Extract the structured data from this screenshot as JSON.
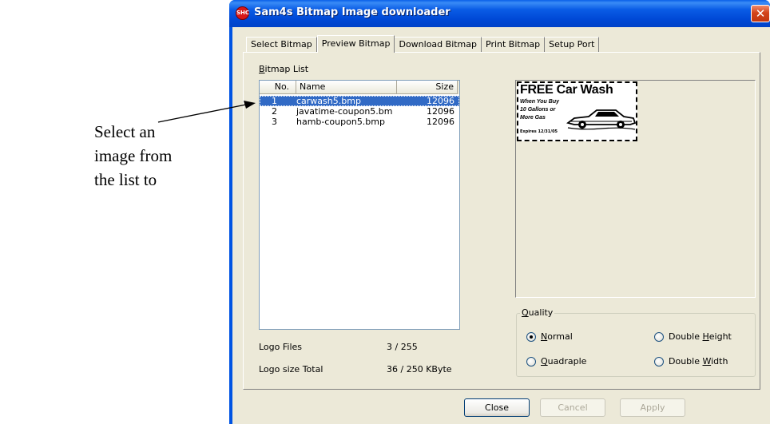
{
  "annotation": {
    "lines": [
      "Select an",
      "image from",
      "the list to"
    ]
  },
  "window": {
    "icon_text": "SHC",
    "title": "Sam4s Bitmap Image downloader",
    "close_glyph": "✕"
  },
  "tabs": [
    {
      "label": "Select Bitmap",
      "active": false
    },
    {
      "label": "Preview Bitmap",
      "active": true
    },
    {
      "label": "Download Bitmap",
      "active": false
    },
    {
      "label": "Print Bitmap",
      "active": false
    },
    {
      "label": "Setup Port",
      "active": false
    }
  ],
  "bitmap_list": {
    "label_prefix": "B",
    "label_rest": "itmap List",
    "columns": {
      "no": "No.",
      "name": "Name",
      "size": "Size"
    },
    "rows": [
      {
        "no": "1",
        "name": "carwash5.bmp",
        "size": "12096",
        "selected": true
      },
      {
        "no": "2",
        "name": "javatime-coupon5.bm",
        "size": "12096",
        "selected": false
      },
      {
        "no": "3",
        "name": "hamb-coupon5.bmp",
        "size": "12096",
        "selected": false
      }
    ]
  },
  "stats": {
    "logo_files_label": "Logo Files",
    "logo_files_value": "3 / 255",
    "logo_size_label": "Logo size Total",
    "logo_size_value": "36 / 250 KByte"
  },
  "preview": {
    "title": "FREE Car Wash",
    "lines": [
      "When You Buy",
      "10 Gallons or",
      "More Gas"
    ],
    "expires": "Expires 12/31/05"
  },
  "quality": {
    "label_prefix": "Q",
    "label_rest": "uality",
    "options": {
      "normal": {
        "pre": "",
        "acc": "N",
        "post": "ormal",
        "checked": true
      },
      "double_height": {
        "pre": "Double ",
        "acc": "H",
        "post": "eight",
        "checked": false
      },
      "quadraple": {
        "pre": "",
        "acc": "Q",
        "post": "uadraple",
        "checked": false
      },
      "double_width": {
        "pre": "Double ",
        "acc": "W",
        "post": "idth",
        "checked": false
      }
    }
  },
  "buttons": {
    "close": "Close",
    "cancel": "Cancel",
    "apply": "Apply"
  }
}
